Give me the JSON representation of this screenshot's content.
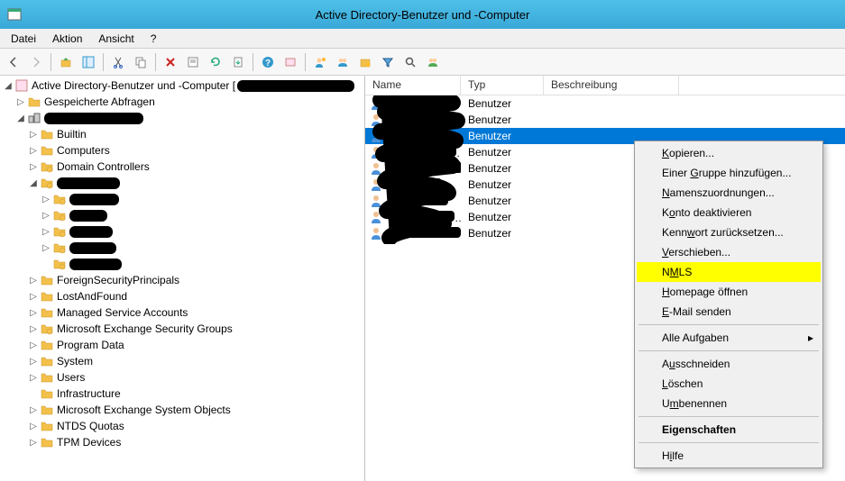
{
  "window": {
    "title": "Active Directory-Benutzer und -Computer"
  },
  "menubar": {
    "items": [
      "Datei",
      "Aktion",
      "Ansicht",
      "?"
    ]
  },
  "tree": {
    "root": "Active Directory-Benutzer und -Computer [",
    "saved_queries": "Gespeicherte Abfragen",
    "domain_children": {
      "builtin": "Builtin",
      "computers": "Computers",
      "dc": "Domain Controllers",
      "redacted_ou": "",
      "r1": "",
      "r2": "",
      "r3": "",
      "r4": "",
      "r5": "",
      "fsp": "ForeignSecurityPrincipals",
      "laf": "LostAndFound",
      "msa": "Managed Service Accounts",
      "mesg": "Microsoft Exchange Security Groups",
      "pd": "Program Data",
      "sys": "System",
      "users": "Users",
      "infra": "Infrastructure",
      "meso": "Microsoft Exchange System Objects",
      "ntds": "NTDS Quotas",
      "tpm": "TPM Devices"
    }
  },
  "list": {
    "columns": {
      "name": "Name",
      "type": "Typ",
      "desc": "Beschreibung"
    },
    "col_widths": {
      "name": 100,
      "type": 92,
      "desc": 150
    },
    "type_value": "Benutzer",
    "rows": [
      {
        "selected": false
      },
      {
        "selected": false
      },
      {
        "selected": true
      },
      {
        "selected": false
      },
      {
        "selected": false
      },
      {
        "selected": false
      },
      {
        "selected": false
      },
      {
        "selected": false
      },
      {
        "selected": false
      }
    ]
  },
  "context_menu": {
    "items": [
      {
        "label_pre": "",
        "u": "K",
        "label_post": "opieren...",
        "type": "item"
      },
      {
        "label_pre": "Einer ",
        "u": "G",
        "label_post": "ruppe hinzufügen...",
        "type": "item"
      },
      {
        "label_pre": "",
        "u": "N",
        "label_post": "amenszuordnungen...",
        "type": "item"
      },
      {
        "label_pre": "K",
        "u": "o",
        "label_post": "nto deaktivieren",
        "type": "item"
      },
      {
        "label_pre": "Kenn",
        "u": "w",
        "label_post": "ort zurücksetzen...",
        "type": "item"
      },
      {
        "label_pre": "",
        "u": "V",
        "label_post": "erschieben...",
        "type": "item"
      },
      {
        "label_pre": "N",
        "u": "M",
        "label_post": "LS",
        "type": "highlight"
      },
      {
        "label_pre": "",
        "u": "H",
        "label_post": "omepage öffnen",
        "type": "item"
      },
      {
        "label_pre": "",
        "u": "E",
        "label_post": "-Mail senden",
        "type": "item"
      },
      {
        "type": "sep"
      },
      {
        "label_pre": "Alle Aufgaben",
        "u": "",
        "label_post": "",
        "type": "submenu"
      },
      {
        "type": "sep"
      },
      {
        "label_pre": "A",
        "u": "u",
        "label_post": "sschneiden",
        "type": "item"
      },
      {
        "label_pre": "",
        "u": "L",
        "label_post": "öschen",
        "type": "item"
      },
      {
        "label_pre": "U",
        "u": "m",
        "label_post": "benennen",
        "type": "item"
      },
      {
        "type": "sep"
      },
      {
        "label_pre": "Eigenschaften",
        "u": "",
        "label_post": "",
        "type": "bold"
      },
      {
        "type": "sep"
      },
      {
        "label_pre": "H",
        "u": "i",
        "label_post": "lfe",
        "type": "item"
      }
    ]
  }
}
